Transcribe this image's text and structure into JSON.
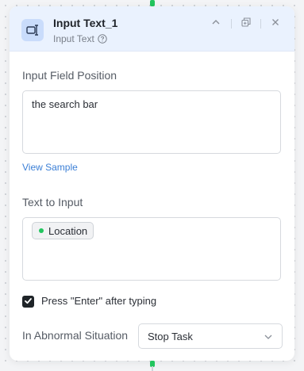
{
  "node": {
    "title": "Input Text_1",
    "subtitle": "Input Text",
    "icons": {
      "node": "text-input-icon",
      "help": "help-circle-icon",
      "collapse": "chevron-up-icon",
      "copy": "duplicate-icon",
      "close": "close-icon"
    }
  },
  "input_field_position": {
    "label": "Input Field Position",
    "value": "the search bar",
    "sample_link": "View Sample"
  },
  "text_to_input": {
    "label": "Text to Input",
    "variable_chip": "Location"
  },
  "press_enter": {
    "label": "Press \"Enter\" after typing",
    "checked": true
  },
  "abnormal_situation": {
    "label": "In Abnormal Situation",
    "selected": "Stop Task"
  },
  "colors": {
    "header_bg": "#eaf2fe",
    "accent_link": "#3b7fd6",
    "connector": "#22c55e",
    "checkbox": "#1f2428"
  }
}
